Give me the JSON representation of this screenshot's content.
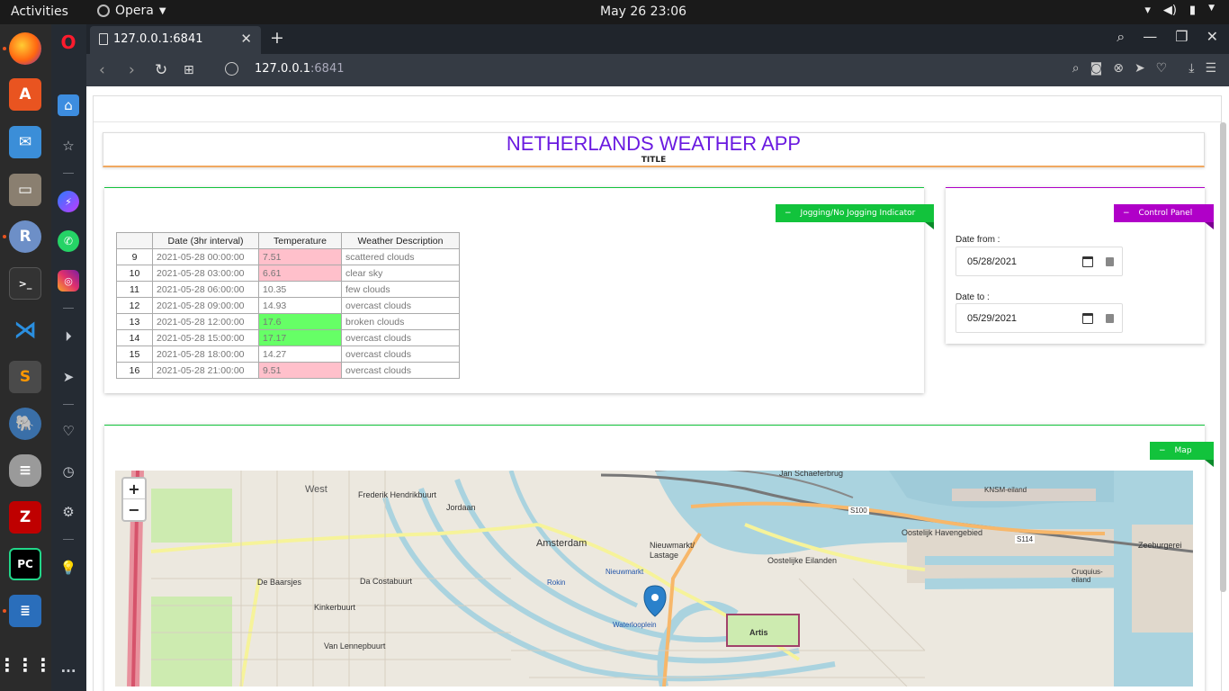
{
  "system": {
    "activities": "Activities",
    "app_name": "Opera",
    "clock": "May 26  23:06"
  },
  "browser": {
    "tab_title": "127.0.0.1:6841",
    "url_host": "127.0.0.1",
    "url_port": ":6841"
  },
  "app": {
    "title": "NETHERLANDS WEATHER APP",
    "subtitle": "TITLE",
    "jogging_ribbon": "Jogging/No Jogging Indicator",
    "control_ribbon": "Control Panel",
    "map_ribbon": "Map",
    "date_from_label": "Date from :",
    "date_from_value": "05/28/2021",
    "date_to_label": "Date to :",
    "date_to_value": "05/29/2021"
  },
  "table": {
    "headers": [
      "",
      "Date (3hr interval)",
      "Temperature",
      "Weather Description"
    ],
    "rows": [
      {
        "idx": "9",
        "date": "2021-05-28 00:00:00",
        "temp": "7.51",
        "desc": "scattered clouds",
        "status": "pink"
      },
      {
        "idx": "10",
        "date": "2021-05-28 03:00:00",
        "temp": "6.61",
        "desc": "clear sky",
        "status": "pink"
      },
      {
        "idx": "11",
        "date": "2021-05-28 06:00:00",
        "temp": "10.35",
        "desc": "few clouds",
        "status": "none"
      },
      {
        "idx": "12",
        "date": "2021-05-28 09:00:00",
        "temp": "14.93",
        "desc": "overcast clouds",
        "status": "none"
      },
      {
        "idx": "13",
        "date": "2021-05-28 12:00:00",
        "temp": "17.6",
        "desc": "broken clouds",
        "status": "green"
      },
      {
        "idx": "14",
        "date": "2021-05-28 15:00:00",
        "temp": "17.17",
        "desc": "overcast clouds",
        "status": "green"
      },
      {
        "idx": "15",
        "date": "2021-05-28 18:00:00",
        "temp": "14.27",
        "desc": "overcast clouds",
        "status": "none"
      },
      {
        "idx": "16",
        "date": "2021-05-28 21:00:00",
        "temp": "9.51",
        "desc": "overcast clouds",
        "status": "pink"
      }
    ]
  },
  "map": {
    "zoom_in": "+",
    "zoom_out": "−",
    "labels": {
      "west": "West",
      "amsterdam": "Amsterdam",
      "frederik": "Frederik Hendrikbuurt",
      "jordaan": "Jordaan",
      "nieuwmarkt": "Nieuwmarkt/ Lastage",
      "oostelijke": "Oostelijke Eilanden",
      "havengebied": "Oostelijk Havengebied",
      "da_costa": "Da Costabuurt",
      "de_baarsjes": "De Baarsjes",
      "kinkerbuurt": "Kinkerbuurt",
      "van_lennep": "Van Lennepbuurt",
      "artis": "Artis",
      "waterlooplein": "Waterlooplein",
      "rokin": "Rokin",
      "cruquius": "Cruquius-eiland",
      "zeeburgereiland": "Zeeburgerei",
      "s100": "S100",
      "s114": "S114",
      "jan_schaeferbrug": "Jan Schaeferbrug",
      "ksnm": "KNSM-eiland",
      "nieuwmarkt_stop": "Nieuwmarkt"
    }
  },
  "colors": {
    "title": "#6a1ae0",
    "green_ribbon": "#12c33c",
    "purple_ribbon": "#b000c8",
    "pink_cell": "#ffc0cb",
    "green_cell": "#66ff66"
  }
}
